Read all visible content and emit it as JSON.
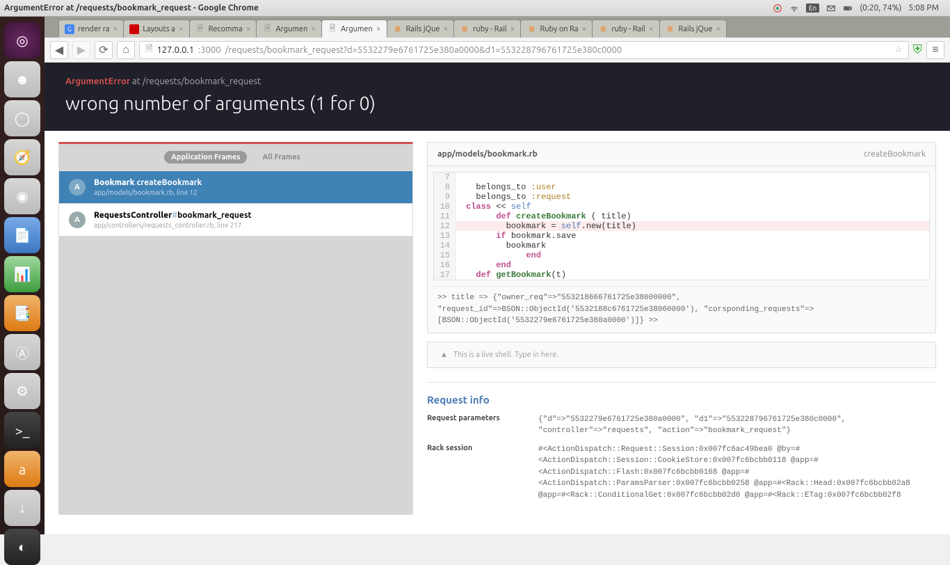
{
  "os": {
    "window_title": "ArgumentError at /requests/bookmark_request - Google Chrome",
    "battery": "(0:20, 74%)",
    "time": "5:08 PM",
    "lang": "En"
  },
  "launcher": [
    {
      "name": "dash-icon",
      "cls": "bg-purple",
      "glyph": "◎"
    },
    {
      "name": "finder-icon",
      "cls": "bg-grey",
      "glyph": "☻"
    },
    {
      "name": "ubuntu-one-icon",
      "cls": "bg-grey",
      "glyph": "◯"
    },
    {
      "name": "safari-icon",
      "cls": "bg-grey",
      "glyph": "🧭"
    },
    {
      "name": "chrome-icon",
      "cls": "bg-grey",
      "glyph": "◉"
    },
    {
      "name": "writer-icon",
      "cls": "bg-blue",
      "glyph": "📄"
    },
    {
      "name": "calc-icon",
      "cls": "bg-green",
      "glyph": "📊"
    },
    {
      "name": "impress-icon",
      "cls": "bg-orange",
      "glyph": "📑"
    },
    {
      "name": "appstore-icon",
      "cls": "bg-grey",
      "glyph": "Ⓐ"
    },
    {
      "name": "settings-icon",
      "cls": "bg-grey",
      "glyph": "⚙"
    },
    {
      "name": "terminal-icon",
      "cls": "bg-dark",
      "glyph": ">_"
    },
    {
      "name": "amazon-icon",
      "cls": "bg-orange",
      "glyph": "a"
    },
    {
      "name": "downloads-icon",
      "cls": "bg-grey",
      "glyph": "↓"
    },
    {
      "name": "steam-icon",
      "cls": "bg-dark",
      "glyph": "◐"
    }
  ],
  "tabs": [
    {
      "label": "render ra",
      "fav": "g",
      "active": false
    },
    {
      "label": "Layouts a",
      "fav": "r",
      "active": false
    },
    {
      "label": "Recomma",
      "fav": "",
      "active": false
    },
    {
      "label": "Argumen",
      "fav": "",
      "active": false
    },
    {
      "label": "Argumen",
      "fav": "",
      "active": true
    },
    {
      "label": "Rails jQue",
      "fav": "s",
      "active": false
    },
    {
      "label": "ruby - Rail",
      "fav": "s",
      "active": false
    },
    {
      "label": "Ruby on Ra",
      "fav": "s",
      "active": false
    },
    {
      "label": "ruby - Rail",
      "fav": "s",
      "active": false
    },
    {
      "label": "Rails jQue",
      "fav": "s",
      "active": false
    }
  ],
  "url": {
    "host": "127.0.0.1",
    "port": ":3000",
    "path": "/requests/bookmark_request?d=5532279e6761725e380a0000&d1=553228796761725e380c0000"
  },
  "error": {
    "name": "ArgumentError",
    "at": " at /requests/bookmark_request",
    "message": "wrong number of arguments (1 for 0)"
  },
  "frames_tabs": {
    "app": "Application Frames",
    "all": "All Frames"
  },
  "frames": [
    {
      "active": true,
      "badge": "A",
      "title_class": "Bookmark",
      "title_sep": ".",
      "title_method": "createBookmark",
      "path": "app/models/bookmark.rb, line 12"
    },
    {
      "active": false,
      "badge": "A",
      "title_class": "RequestsController",
      "title_sep": "#",
      "title_method": "bookmark_request",
      "path": "app/controllers/requests_controller.rb, line 217"
    }
  ],
  "code": {
    "file": "app/models/bookmark.rb",
    "method": "createBookmark",
    "lines": [
      {
        "n": 7,
        "raw": ""
      },
      {
        "n": 8,
        "raw": "  belongs_to <sym>:user</sym>"
      },
      {
        "n": 9,
        "raw": "  belongs_to <sym>:request</sym>"
      },
      {
        "n": 10,
        "raw": "<kw>class</kw> &lt;&lt; <self>self</self>"
      },
      {
        "n": 11,
        "raw": "      <kw>def</kw> <fn>createBookmark</fn> ( title)"
      },
      {
        "n": 12,
        "hl": true,
        "raw": "        bookmark = <self>self</self>.new(title)"
      },
      {
        "n": 13,
        "raw": "      <kw>if</kw> bookmark.save"
      },
      {
        "n": 14,
        "raw": "        bookmark"
      },
      {
        "n": 15,
        "raw": "            <kw>end</kw>"
      },
      {
        "n": 16,
        "raw": "      <kw>end</kw>"
      },
      {
        "n": 17,
        "raw": "  <kw>def</kw> <fn>getBookmark</fn>(t)"
      }
    ],
    "console": ">> title\n=> {\"owner_req\"=>\"553218666761725e38000000\", \"request_id\"=>BSON::ObjectId('5532188c6761725e38060000'), \"corsponding_requests\"=>[BSON::ObjectId('5532279e6761725e380a0000')]}\n>>"
  },
  "shell_hint": "This is a live shell. Type in here.",
  "request_info": {
    "title": "Request info",
    "params_label": "Request parameters",
    "params_value": "{\"d\"=>\"5532279e6761725e380a0000\", \"d1\"=>\"553228796761725e380c0000\", \"controller\"=>\"requests\", \"action\"=>\"bookmark_request\"}",
    "rack_label": "Rack session",
    "rack_value": "#<ActionDispatch::Request::Session:0x007fc6ac49bea0 @by=#<ActionDispatch::Session::CookieStore:0x007fc6bcbb0118 @app=#<ActionDispatch::Flash:0x007fc6bcbb0168 @app=#<ActionDispatch::ParamsParser:0x007fc6bcbb0258 @app=#<Rack::Head:0x007fc6bcbb02a8 @app=#<Rack::ConditionalGet:0x007fc6bcbb02d0 @app=#<Rack::ETag:0x007fc6bcbb02f8"
  }
}
